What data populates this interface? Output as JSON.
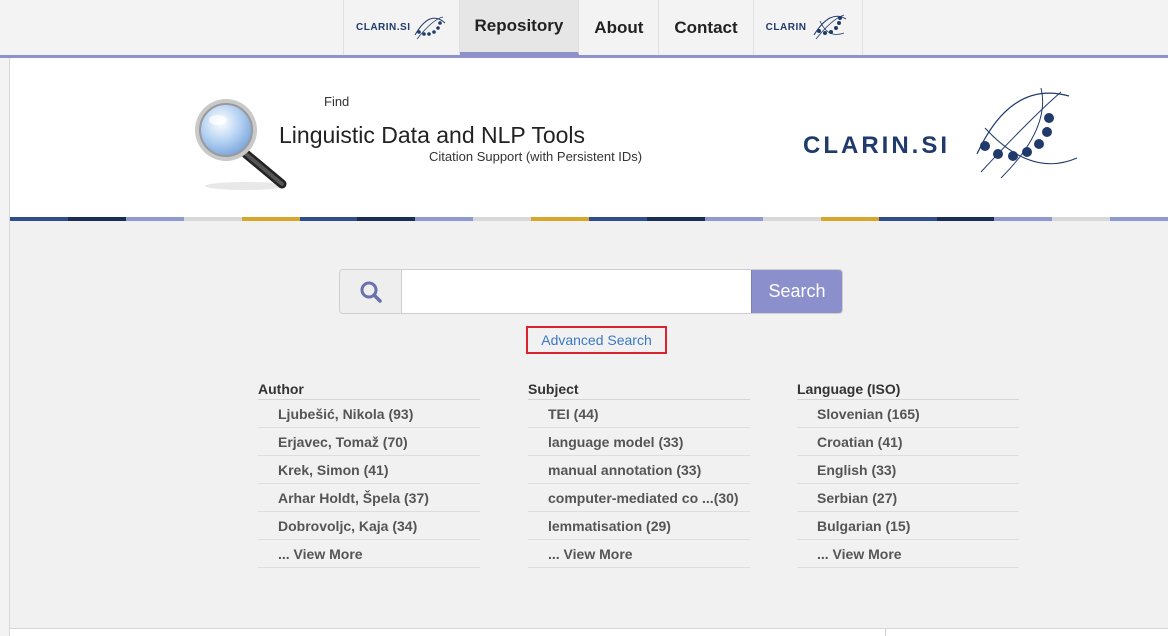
{
  "nav": {
    "left_logo_text": "CLARIN.SI",
    "items": [
      {
        "label": "Repository",
        "active": true
      },
      {
        "label": "About",
        "active": false
      },
      {
        "label": "Contact",
        "active": false
      }
    ],
    "right_logo_text": "CLARIN"
  },
  "banner": {
    "find": "Find",
    "title": "Linguistic Data and NLP Tools",
    "subtitle": "Citation Support (with Persistent IDs)",
    "logo_text": "CLARIN.SI"
  },
  "search": {
    "placeholder": "",
    "button_label": "Search",
    "advanced_label": "Advanced Search"
  },
  "facets": [
    {
      "heading": "Author",
      "items": [
        "Ljubešić, Nikola (93)",
        "Erjavec, Tomaž (70)",
        "Krek, Simon (41)",
        "Arhar Holdt, Špela (37)",
        "Dobrovoljc, Kaja (34)"
      ],
      "more": "... View More"
    },
    {
      "heading": "Subject",
      "items": [
        "TEI (44)",
        "language model (33)",
        "manual annotation (33)",
        "computer-mediated co ...(30)",
        "lemmatisation (29)"
      ],
      "more": "... View More"
    },
    {
      "heading": "Language (ISO)",
      "items": [
        "Slovenian (165)",
        "Croatian (41)",
        "English (33)",
        "Serbian (27)",
        "Bulgarian (15)"
      ],
      "more": "... View More"
    }
  ],
  "colors": {
    "accent": "#8b8fcc",
    "stripe": [
      "#2f4e8e",
      "#1c2d55",
      "#8e99d0",
      "#d8d8d8",
      "#d9a62c"
    ],
    "advanced_border": "#d9232e",
    "link": "#3a78c3"
  }
}
